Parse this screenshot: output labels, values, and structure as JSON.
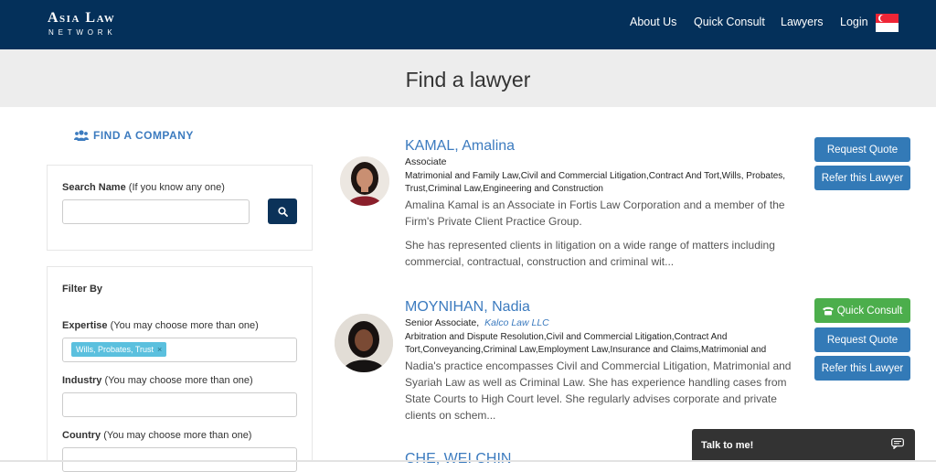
{
  "header": {
    "logo_main": "Asia Law",
    "logo_sub": "NETWORK",
    "nav": [
      {
        "label": "About Us"
      },
      {
        "label": "Quick Consult"
      },
      {
        "label": "Lawyers"
      },
      {
        "label": "Login"
      }
    ],
    "flag_icon": "singapore-flag-icon"
  },
  "hero": {
    "title": "Find a lawyer"
  },
  "sidebar": {
    "find_company": "FIND A COMPANY",
    "search_name_label": "Search Name",
    "search_name_hint": " (If you know any one)",
    "search_name_value": "",
    "filter_by": "Filter By",
    "expertise_label": "Expertise",
    "expertise_hint": " (You may choose more than one)",
    "expertise_tag": "Wills, Probates, Trust",
    "industry_label": "Industry",
    "industry_hint": " (You may choose more than one)",
    "country_label": "Country",
    "country_hint": " (You may choose more than one)"
  },
  "lawyers": [
    {
      "name": "KAMAL, Amalina",
      "role": "Associate",
      "firm": "",
      "areas": "Matrimonial and Family Law,Civil and Commercial Litigation,Contract And Tort,Wills, Probates, Trust,Criminal Law,Engineering and Construction",
      "desc1": "Amalina Kamal is an Associate in Fortis Law Corporation and a member of the Firm's Private Client Practice Group.",
      "desc2": "She has represented clients in litigation on a wide range of matters including commercial, contractual, construction and criminal wit...",
      "buttons": [
        "Request Quote",
        "Refer this Lawyer"
      ]
    },
    {
      "name": "MOYNIHAN, Nadia",
      "role": "Senior Associate,",
      "firm": "Kalco Law LLC",
      "areas": "Arbitration and Dispute Resolution,Civil and Commercial Litigation,Contract And Tort,Conveyancing,Criminal Law,Employment Law,Insurance and Claims,Matrimonial and",
      "desc1": "Nadia's practice encompasses Civil and Commercial Litigation, Matrimonial and Syariah Law as well as Criminal Law. She has experience handling cases from State Courts to High Court level. She regularly advises corporate and private clients on schem...",
      "buttons": [
        "Quick Consult",
        "Request Quote",
        "Refer this Lawyer"
      ]
    },
    {
      "name": "CHE, WEI CHIN"
    }
  ],
  "chat": {
    "label": "Talk to me!"
  },
  "colors": {
    "navy": "#04305a",
    "link": "#3c7bbf",
    "blue_button": "#337ab7",
    "green_button": "#4cae4c"
  }
}
